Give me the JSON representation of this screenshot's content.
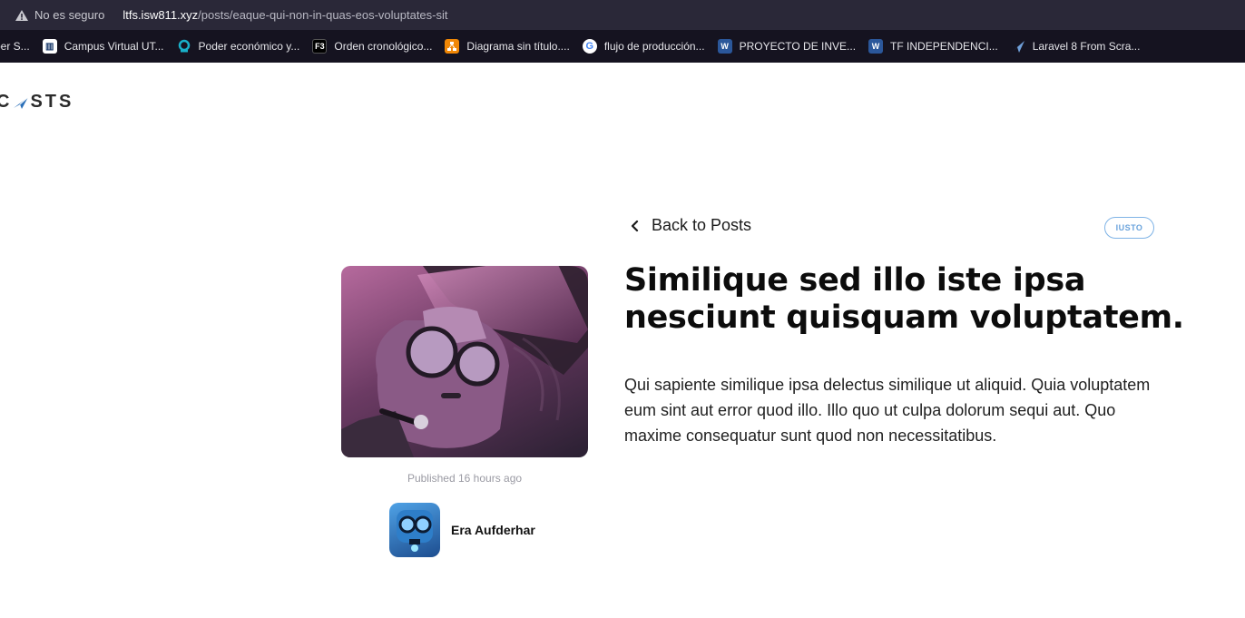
{
  "browser": {
    "security_label": "No es seguro",
    "url_host": "ltfs.isw811.xyz",
    "url_path": "/posts/eaque-qui-non-in-quas-eos-voluptates-sit"
  },
  "bookmarks": [
    {
      "label": "per S...",
      "icon": "bookmark-icon",
      "color": "#3a3a3a"
    },
    {
      "label": "Campus Virtual UT...",
      "icon": "campus-icon",
      "color": "#ffffff"
    },
    {
      "label": "Poder económico y...",
      "icon": "globe-icon",
      "color": "#19b0c9"
    },
    {
      "label": "Orden cronológico...",
      "icon": "f3-icon",
      "color": "#000000"
    },
    {
      "label": "Diagrama sin título....",
      "icon": "drawio-icon",
      "color": "#f08705"
    },
    {
      "label": "flujo de producción...",
      "icon": "google-icon",
      "color": "#ffffff"
    },
    {
      "label": "PROYECTO DE INVE...",
      "icon": "word-icon",
      "color": "#2b579a"
    },
    {
      "label": "TF INDEPENDENCI...",
      "icon": "word-icon",
      "color": "#2b579a"
    },
    {
      "label": "Laravel 8 From Scra...",
      "icon": "plane-icon",
      "color": "#151320"
    }
  ],
  "logo": {
    "text_left": "C",
    "text_right": "STS"
  },
  "post": {
    "back_label": "Back to Posts",
    "category": "IUSTO",
    "title": "Similique sed illo iste ipsa nesciunt quisquam voluptatem.",
    "body": "Qui sapiente similique ipsa delectus similique ut aliquid. Quia voluptatem eum sint aut error quod illo. Illo quo ut culpa dolorum sequi aut. Quo maxime consequatur sunt quod non necessitatibus.",
    "published": "Published 16 hours ago",
    "author": "Era Aufderhar"
  },
  "colors": {
    "accent": "#6aa3dc",
    "topbar": "#2a2838",
    "bookmarks_bg": "#151320"
  }
}
